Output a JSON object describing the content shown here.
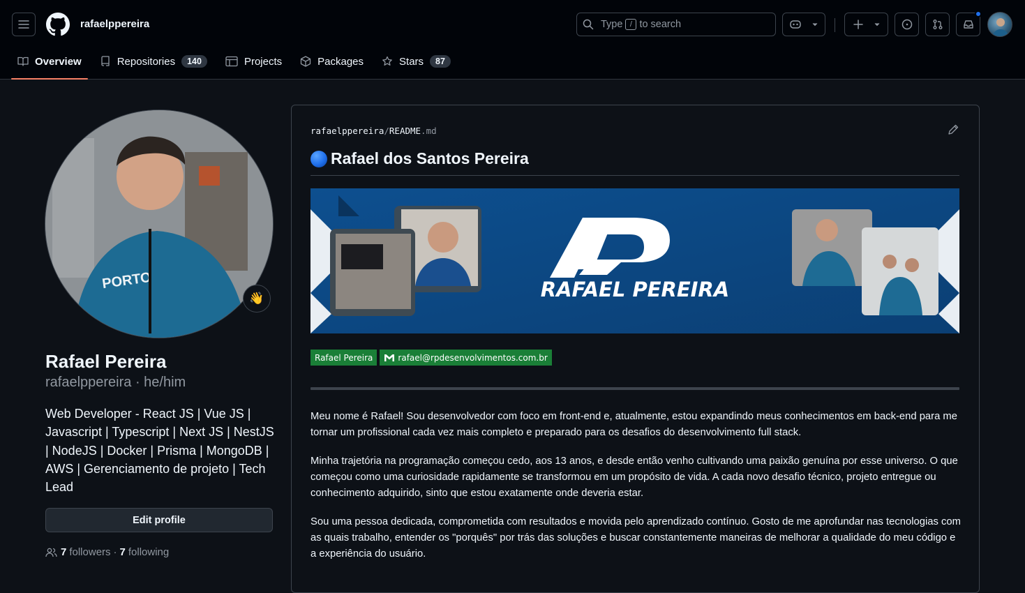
{
  "header": {
    "username": "rafaelppereira",
    "search_prefix": "Type",
    "search_key": "/",
    "search_suffix": "to search"
  },
  "tabs": [
    {
      "label": "Overview",
      "count": ""
    },
    {
      "label": "Repositories",
      "count": "140"
    },
    {
      "label": "Projects",
      "count": ""
    },
    {
      "label": "Packages",
      "count": ""
    },
    {
      "label": "Stars",
      "count": "87"
    }
  ],
  "profile": {
    "name": "Rafael Pereira",
    "login_line": "rafaelppereira · he/him",
    "status_emoji": "👋",
    "bio": "Web Developer - React JS | Vue JS | Javascript | Typescript | Next JS | NestJS | NodeJS | Docker | Prisma | MongoDB | AWS | Gerenciamento de projeto | Tech Lead",
    "edit_label": "Edit profile",
    "followers_count": "7",
    "followers_label": "followers",
    "separator": "·",
    "following_count": "7",
    "following_label": "following"
  },
  "readme": {
    "path_owner": "rafaelppereira",
    "path_sep": "/",
    "path_file": "README",
    "path_ext": ".md",
    "title": "Rafael dos Santos Pereira",
    "banner_text": "RAFAEL PEREIRA",
    "banner_logo": "RP",
    "badge_name": "Rafael Pereira",
    "badge_email": "rafael@rpdesenvolvimentos.com.br",
    "paragraphs": [
      "Meu nome é Rafael! Sou desenvolvedor com foco em front-end e, atualmente, estou expandindo meus conhecimentos em back-end para me tornar um profissional cada vez mais completo e preparado para os desafios do desenvolvimento full stack.",
      "Minha trajetória na programação começou cedo, aos 13 anos, e desde então venho cultivando uma paixão genuína por esse universo. O que começou como uma curiosidade rapidamente se transformou em um propósito de vida. A cada novo desafio técnico, projeto entregue ou conhecimento adquirido, sinto que estou exatamente onde deveria estar.",
      "Sou uma pessoa dedicada, comprometida com resultados e movida pelo aprendizado contínuo. Gosto de me aprofundar nas tecnologias com as quais trabalho, entender os \"porquês\" por trás das soluções e buscar constantemente maneiras de melhorar a qualidade do meu código e a experiência do usuário."
    ]
  },
  "colors": {
    "background": "#0d1117",
    "header": "#010409",
    "accent_underline": "#f78166",
    "badge_green": "#1a7f37",
    "banner_blue": "#0e4d8c"
  }
}
